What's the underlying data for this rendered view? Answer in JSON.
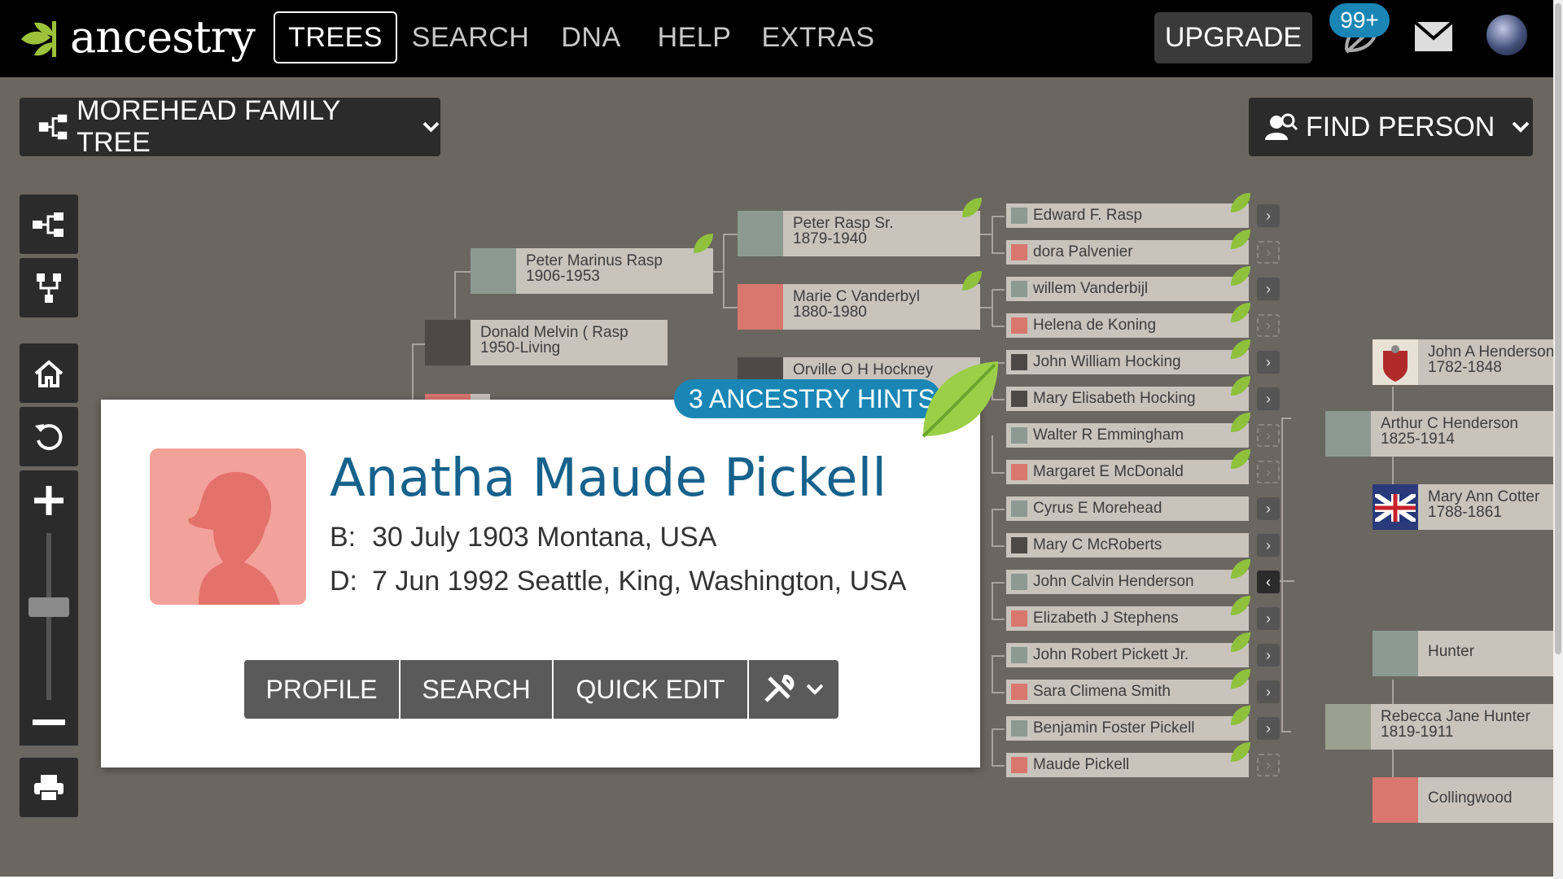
{
  "nav": {
    "logo_text": "ancestry",
    "trees": "TREES",
    "search": "SEARCH",
    "dna": "DNA",
    "help": "HELP",
    "extras": "EXTRAS",
    "upgrade": "UPGRADE",
    "hint_count": "99+"
  },
  "tree_selector": "MOREHEAD FAMILY TREE",
  "find_person": "FIND PERSON",
  "tools": [
    "pedigree-view-icon",
    "family-view-icon",
    "home-icon",
    "reset-icon",
    "zoom-in-icon",
    "zoom-slider",
    "zoom-out-icon",
    "print-icon"
  ],
  "tree": {
    "gen1": {
      "name": "Donald Melvin ( Rasp",
      "years": "1950-Living"
    },
    "gen2": {
      "name": "Peter Marinus Rasp",
      "years": "1906-1953"
    },
    "gen3": [
      {
        "name": "Peter Rasp Sr.",
        "years": "1879-1940"
      },
      {
        "name": "Marie C Vanderbyl",
        "years": "1880-1980"
      },
      {
        "name": "Orville O H Hockney",
        "years": ""
      }
    ],
    "gen4": [
      "Edward F. Rasp",
      "dora Palvenier",
      "willem Vanderbijl",
      "Helena de Koning",
      "John William Hocking",
      "Mary Elisabeth Hocking",
      "Walter R Emmingham",
      "Margaret E McDonald",
      "Cyrus E Morehead",
      "Mary C McRoberts",
      "John Calvin Henderson",
      "Elizabeth J Stephens",
      "John Robert Pickett Jr.",
      "Sara Climena Smith",
      "Benjamin Foster Pickell",
      "Maude Pickell"
    ],
    "gen5": [
      {
        "name": "John A Henderson",
        "years": "1782-1848"
      },
      {
        "name": "Arthur C Henderson",
        "years": "1825-1914"
      },
      {
        "name": "Mary Ann Cotter",
        "years": "1788-1861"
      },
      {
        "name": "Hunter",
        "years": ""
      },
      {
        "name": "Rebecca Jane Hunter",
        "years": "1819-1911"
      },
      {
        "name": "Collingwood",
        "years": ""
      }
    ]
  },
  "card": {
    "hints": "3 ANCESTRY HINTS",
    "name": "Anatha Maude Pickell",
    "birth_label": "B:",
    "birth": "30 July 1903 Montana, USA",
    "death_label": "D:",
    "death": "7 Jun 1992 Seattle, King, Washington, USA",
    "actions": {
      "profile": "PROFILE",
      "search": "SEARCH",
      "quick_edit": "QUICK EDIT"
    }
  },
  "colors": {
    "brand_green": "#9cc13b",
    "hint_blue": "#1a86b5",
    "name_blue": "#16628c",
    "canvas": "#6a6660"
  }
}
